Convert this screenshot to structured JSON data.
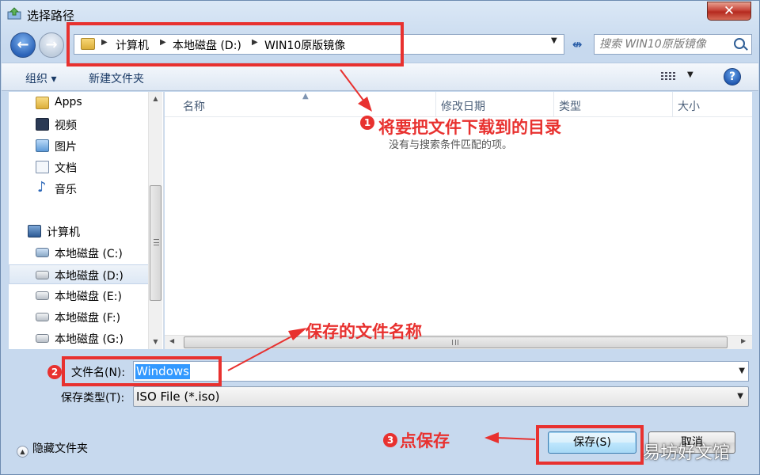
{
  "window": {
    "title": "选择路径",
    "close_label": "✕"
  },
  "nav": {
    "back_label": "←",
    "forward_label": "→",
    "breadcrumbs": [
      "计算机",
      "本地磁盘 (D:)",
      "WIN10原版镜像"
    ],
    "refresh_label": "↮",
    "search_placeholder": "搜索 WIN10原版镜像"
  },
  "toolbar": {
    "organize_label": "组织 ▾",
    "new_folder_label": "新建文件夹",
    "help_label": "?"
  },
  "sidebar": {
    "items": [
      {
        "label": "Apps",
        "icon": "folder-icon"
      },
      {
        "label": "视频",
        "icon": "video-icon"
      },
      {
        "label": "图片",
        "icon": "pictures-icon"
      },
      {
        "label": "文档",
        "icon": "documents-icon"
      },
      {
        "label": "音乐",
        "icon": "music-icon"
      },
      {
        "label": "计算机",
        "icon": "computer-icon"
      },
      {
        "label": "本地磁盘 (C:)",
        "icon": "system-drive-icon"
      },
      {
        "label": "本地磁盘 (D:)",
        "icon": "drive-icon",
        "selected": true
      },
      {
        "label": "本地磁盘 (E:)",
        "icon": "drive-icon"
      },
      {
        "label": "本地磁盘 (F:)",
        "icon": "drive-icon"
      },
      {
        "label": "本地磁盘 (G:)",
        "icon": "drive-icon"
      }
    ]
  },
  "content": {
    "columns": [
      "名称",
      "修改日期",
      "类型",
      "大小"
    ],
    "empty_message": "没有与搜索条件匹配的项。"
  },
  "form": {
    "filename_label": "文件名(N):",
    "filename_value": "Windows",
    "filetype_label": "保存类型(T):",
    "filetype_value": "ISO File (*.iso)",
    "hide_folders_label": "隐藏文件夹",
    "save_label": "保存(S)",
    "cancel_label": "取消"
  },
  "annotations": {
    "step1_number": "1",
    "step1_text": "将要把文件下载到的目录",
    "step2_number": "2",
    "step2_text": "保存的文件名称",
    "step3_number": "3",
    "step3_text": "点保存",
    "accent_color": "#e8312f"
  },
  "watermark": "易坊好文馆"
}
